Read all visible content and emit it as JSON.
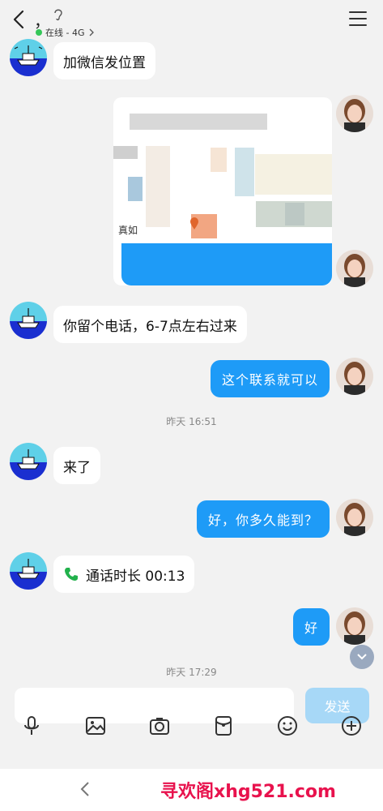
{
  "header": {
    "title_mark": "，",
    "status_text": "在线 - 4G"
  },
  "messages": {
    "m1": "加微信发位置",
    "map_label": "真如",
    "m3": "你留个电话，6-7点左右过来",
    "m4": "这个联系就可以",
    "time1": "昨天 16:51",
    "m5": "来了",
    "m6": "好，你多久能到？",
    "m7_call": "通话时长 00:13",
    "m8": "好",
    "time2": "昨天 17:29"
  },
  "composer": {
    "input_value": "",
    "send_label": "发送"
  },
  "toolbar": {
    "icons": [
      "microphone-icon",
      "image-icon",
      "camera-icon",
      "red-packet-icon",
      "emoji-icon",
      "plus-icon"
    ]
  },
  "watermark": {
    "text": "寻欢阁xhg521.com"
  },
  "colors": {
    "bubble_blue": "#1e9bf7",
    "online_green": "#35c759",
    "send_disabled": "#a7d8f7",
    "watermark_red": "#e8124d"
  }
}
